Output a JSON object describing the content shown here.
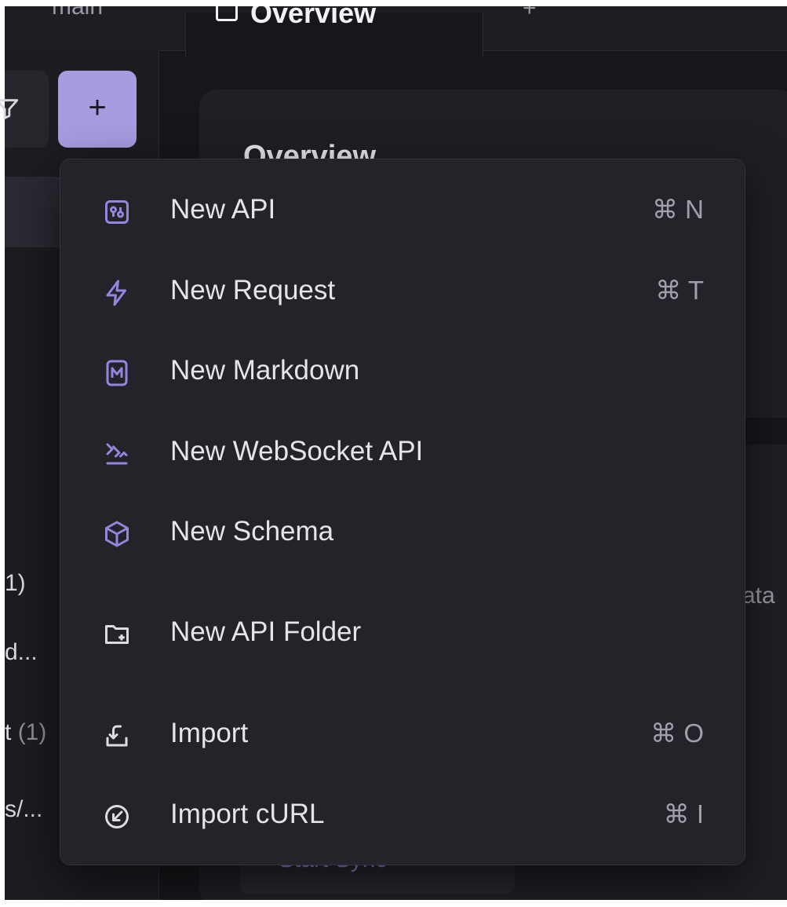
{
  "tabs": {
    "main_label": "main",
    "overview_label": "Overview",
    "add_label": "+"
  },
  "toolbar": {
    "add_button_label": "+"
  },
  "main": {
    "heading": "Overview",
    "data_fragment": "ata",
    "sync_button_label": "Start Sync"
  },
  "sidebar": {
    "fragments": [
      {
        "text": "1)",
        "count": ""
      },
      {
        "text": "d...",
        "count": ""
      },
      {
        "text": "t",
        "count": "(1)"
      },
      {
        "text": "s/...",
        "count": ""
      }
    ]
  },
  "menu": {
    "items": [
      {
        "label": "New API",
        "shortcut": "⌘ N",
        "icon": "api-icon"
      },
      {
        "label": "New Request",
        "shortcut": "⌘ T",
        "icon": "lightning-icon"
      },
      {
        "label": "New Markdown",
        "shortcut": "",
        "icon": "markdown-icon"
      },
      {
        "label": "New WebSocket API",
        "shortcut": "",
        "icon": "websocket-icon"
      },
      {
        "label": "New Schema",
        "shortcut": "",
        "icon": "cube-icon"
      },
      {
        "label": "New API Folder",
        "shortcut": "",
        "icon": "folder-plus-icon"
      },
      {
        "label": "Import",
        "shortcut": "⌘ O",
        "icon": "import-icon"
      },
      {
        "label": "Import cURL",
        "shortcut": "⌘ I",
        "icon": "curl-import-icon"
      }
    ]
  },
  "colors": {
    "accent": "#9485dd",
    "add_button": "#a89ce0",
    "menu_bg": "#23232a",
    "app_bg": "#17171b"
  }
}
